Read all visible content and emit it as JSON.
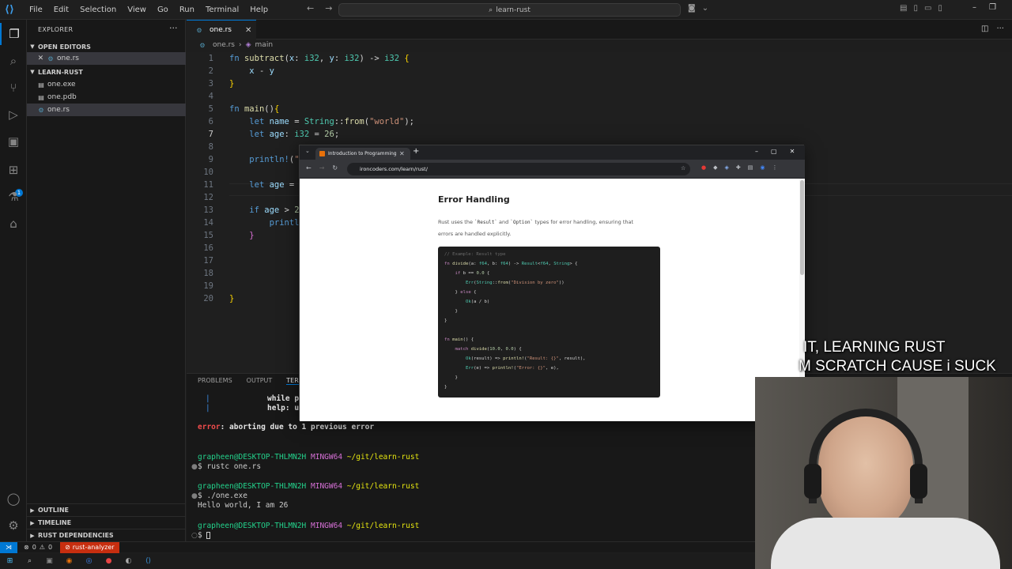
{
  "titlebar": {
    "menu": [
      "File",
      "Edit",
      "Selection",
      "View",
      "Go",
      "Run",
      "Terminal",
      "Help"
    ],
    "search_text": "learn-rust"
  },
  "sidebar": {
    "title": "EXPLORER",
    "open_editors_label": "OPEN EDITORS",
    "open_editors": [
      {
        "name": "one.rs"
      }
    ],
    "project_label": "LEARN-RUST",
    "files": [
      {
        "name": "one.exe"
      },
      {
        "name": "one.pdb"
      },
      {
        "name": "one.rs"
      }
    ],
    "outline_label": "OUTLINE",
    "timeline_label": "TIMELINE",
    "deps_label": "RUST DEPENDENCIES"
  },
  "editor": {
    "tab_label": "one.rs",
    "breadcrumb": {
      "file": "one.rs",
      "symbol": "main"
    },
    "line_numbers": [
      "1",
      "2",
      "3",
      "4",
      "5",
      "6",
      "7",
      "8",
      "9",
      "10",
      "11",
      "12",
      "13",
      "14",
      "15",
      "16",
      "17",
      "18",
      "19",
      "20"
    ],
    "current_line": "7"
  },
  "panel": {
    "tabs": [
      "PROBLEMS",
      "OUTPUT",
      "TERMI"
    ],
    "terminal": {
      "frag1": "while p",
      "frag2": "help: u",
      "error_label": "error",
      "error_msg": ": aborting due to 1 previous error",
      "user": "grapheen@DESKTOP-THLMN2H",
      "shell": "MINGW64",
      "path": "~/git/learn-rust",
      "prompt": "$",
      "cmd1": "rustc one.rs",
      "cmd2": "./one.exe",
      "output": "Hello world, I am 26"
    }
  },
  "statusbar": {
    "errors": "0",
    "warnings": "0",
    "rust_analyzer": "rust-analyzer"
  },
  "browser": {
    "tab_title": "Introduction to Programming",
    "url": "ironcoders.com/learn/rust/",
    "heading": "Error Handling",
    "para_1": "Rust uses the",
    "para_code_1": "`Result`",
    "para_and": "and",
    "para_code_2": "`Option`",
    "para_2": "types for error handling, ensuring that",
    "para_3": "errors are handled explicitly.",
    "code_comment": "// Example: Result type"
  },
  "overlay": {
    "line1": "IT, LEARNING RUST",
    "line2": "M SCRATCH CAUSE i SUCK"
  },
  "colors": {
    "accent": "#0078d4",
    "rust_analyzer_bg": "#c72e0f",
    "editor_bg": "#1f1f1f"
  }
}
